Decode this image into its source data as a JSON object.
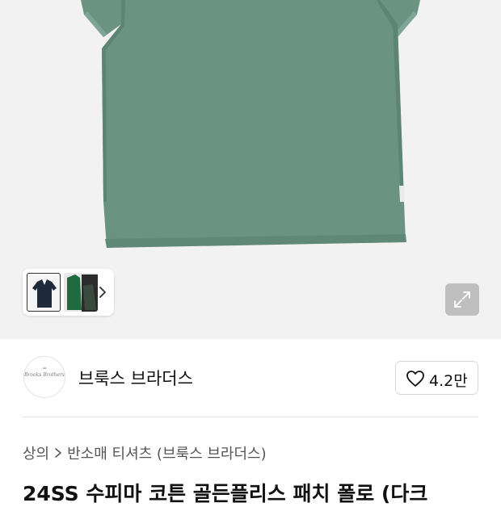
{
  "product_image": {
    "alt": "",
    "shirt_color": "#6a9382",
    "background_color": "#f2f2f2"
  },
  "thumbnails": {
    "items": [
      {
        "name": "thumb-navy-polo",
        "color": "#1f2a3a"
      },
      {
        "name": "thumb-green-polo-model",
        "color": "#1e6b3f"
      }
    ],
    "next_icon": "chevron-right-icon"
  },
  "expand_icon": "expand-arrows-icon",
  "brand": {
    "name": "브룩스 브라더스",
    "logo_text": "Brooks Brothers",
    "logo_mark": "≈"
  },
  "like": {
    "icon": "heart-icon",
    "count": "4.2만"
  },
  "breadcrumb": {
    "items": [
      "상의",
      "반소매 티셔츠 (브룩스 브라더스)"
    ]
  },
  "product": {
    "title": "24SS 수피마 코튼 골든플리스 패치 폴로 (다크"
  }
}
